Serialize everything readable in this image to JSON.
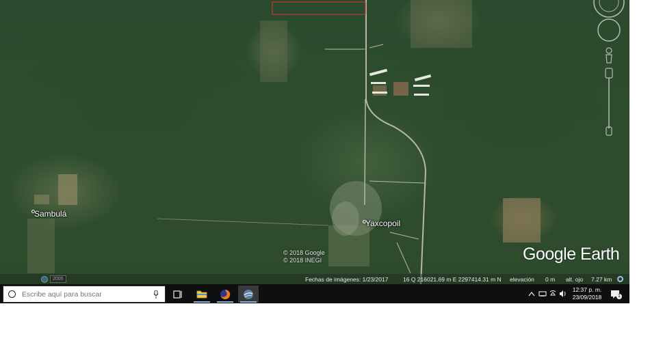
{
  "map": {
    "places": [
      {
        "name": "Sambulá"
      },
      {
        "name": "Yaxcopoil"
      }
    ],
    "copyright": [
      "© 2018 Google",
      "© 2018 INEGI"
    ],
    "logo": "Google Earth",
    "history_year": "2005",
    "status": {
      "imagery_date": "Fechas de imágenes: 1/23/2017",
      "coords": "16 Q 216021.69 m E 2297414.31 m N",
      "elevation_label": "elevación",
      "elevation_value": "0 m",
      "eye_alt_label": "alt. ojo",
      "eye_alt_value": "7.27 km"
    },
    "icons": {
      "look": "look-joystick-icon",
      "move": "move-joystick-icon",
      "pegman": "street-view-pegman-icon",
      "zoom": "zoom-slider-icon",
      "history": "clock-history-icon",
      "globe": "streaming-status-icon"
    }
  },
  "taskbar": {
    "search_placeholder": "Escribe aquí para buscar",
    "apps": [
      {
        "name": "task-view"
      },
      {
        "name": "file-explorer"
      },
      {
        "name": "firefox"
      },
      {
        "name": "google-earth"
      }
    ],
    "time": "12:37 p. m.",
    "date": "23/09/2018",
    "notification_count": "1"
  },
  "colors": {
    "forest": "#2d4b2c",
    "taskbar": "#0f0f0f",
    "accent_blue": "#7fb0e0",
    "boundary_red": "#c0392b"
  }
}
